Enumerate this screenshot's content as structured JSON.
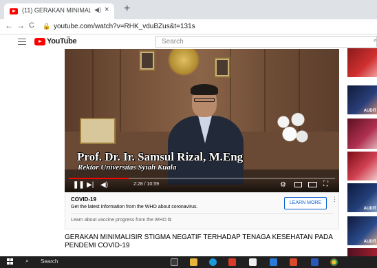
{
  "browser": {
    "tab_title": "(11) GERAKAN MINIMALISIR",
    "tab_audio_icon": "speaker-icon",
    "tab_close": "×",
    "new_tab": "+",
    "back": "←",
    "forward": "→",
    "reload": "C",
    "url": "youtube.com/watch?v=RHK_vduBZus&t=131s"
  },
  "youtube": {
    "logo_text": "YouTube",
    "logo_sup": "ID",
    "search_placeholder": "Search"
  },
  "video": {
    "caption_name": "Prof. Dr. Ir. Samsul Rizal, M.Eng",
    "caption_role": "Rektor Universitas Syiah Kuala",
    "time_current": "2:28",
    "time_total": "10:59",
    "time_display": "2:28 / 10:59",
    "progress_fraction": 0.225
  },
  "covid_panel": {
    "title": "COVID-19",
    "text": "Get the latest information from the WHO about coronavirus.",
    "button": "LEARN MORE",
    "more": "⋮",
    "link": "Learn about vaccine progress from the WHO ⧉"
  },
  "video_title": "GERAKAN MINIMALISIR STIGMA NEGATIF TERHADAP TENAGA KESEHATAN PADA PENDEMI COVID-19",
  "sidebar": {
    "thumb_labels": [
      "",
      "AUDIT",
      "",
      "",
      "AUDIT",
      "AUDIT",
      ""
    ]
  },
  "taskbar": {
    "search_label": "Search"
  },
  "colors": {
    "yt_red": "#ff0000",
    "link_blue": "#065fd4",
    "taskbar": "#202020"
  }
}
